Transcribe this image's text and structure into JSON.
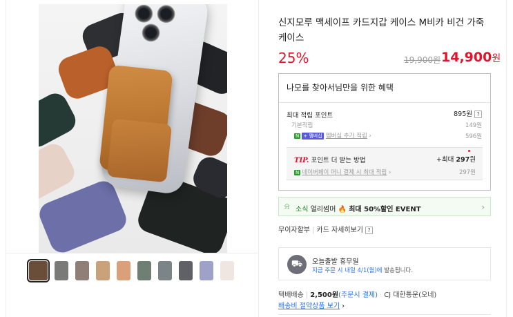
{
  "product": {
    "title": "신지모루 맥세이프 카드지갑 케이스 M비카 비건 가죽 케이스",
    "discount_rate": "25%",
    "original_price": "19,900원",
    "sale_price": "14,900",
    "sale_price_unit": "원"
  },
  "gallery": {
    "thumbnail_colors": [
      "#6b4e3a",
      "#7a7a78",
      "#8f7f76",
      "#c9a27a",
      "#d9a07a",
      "#6f7f74",
      "#7b8486",
      "#5f6166",
      "#9ea1c8",
      "#efe6e2"
    ],
    "selected_index": 0
  },
  "benefits": {
    "heading": "나모를 찾아서님만을 위한 혜택",
    "max_points_label": "최대 적립 포인트",
    "max_points_value": "895원",
    "help": "?",
    "base_label": "기본적립",
    "base_value": "149원",
    "membership_badge_n": "N",
    "membership_badge_plus": "+ 멤버십",
    "membership_label": "멤버십 추가 적립",
    "membership_value": "596원",
    "tip_label": "TIP.",
    "tip_text": "포인트 더 받는 방법",
    "tip_max": "+최대",
    "tip_max_value": "297",
    "tip_max_unit": "원",
    "npay_badge": "N",
    "npay_label": "네이버페이 머니 결제 시 최대 적립",
    "npay_value": "297원"
  },
  "event": {
    "icon": "bell-icon",
    "prefix": "소식",
    "text": "얼리썸머",
    "highlight": "최대 50%할인 EVENT"
  },
  "installment": {
    "no_interest": "무이자할부",
    "card_detail": "카드 자세히보기",
    "help": "?"
  },
  "delivery": {
    "icon": "truck-icon",
    "title": "오늘출발 휴무일",
    "sub_highlight": "지금 주문 시 내일 4/1(월)에",
    "sub_rest": "발송됩니다."
  },
  "shipping": {
    "label": "택배배송",
    "fee": "2,500원",
    "fee_note": "(주문시 결제)",
    "carrier": "CJ 대한통운(오네)",
    "bundle_link": "배송비 절약상품 보기"
  }
}
